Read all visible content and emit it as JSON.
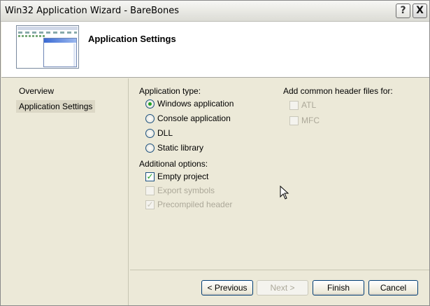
{
  "window": {
    "title": "Win32 Application Wizard - BareBones"
  },
  "titlebar": {
    "help": "?",
    "close": "X"
  },
  "header": {
    "title": "Application Settings",
    "thumbnail_icon": "window-preview-icon"
  },
  "nav": {
    "items": [
      {
        "label": "Overview",
        "selected": false
      },
      {
        "label": "Application Settings",
        "selected": true
      }
    ]
  },
  "app_type": {
    "label": "Application type:",
    "options": [
      {
        "label": "Windows application",
        "checked": true
      },
      {
        "label": "Console application",
        "checked": false
      },
      {
        "label": "DLL",
        "checked": false
      },
      {
        "label": "Static library",
        "checked": false
      }
    ]
  },
  "additional": {
    "label": "Additional options:",
    "options": [
      {
        "label": "Empty project",
        "checked": true,
        "enabled": true
      },
      {
        "label": "Export symbols",
        "checked": false,
        "enabled": false
      },
      {
        "label": "Precompiled header",
        "checked": true,
        "enabled": false
      }
    ]
  },
  "headers": {
    "label": "Add common header files for:",
    "options": [
      {
        "label": "ATL",
        "checked": false,
        "enabled": false
      },
      {
        "label": "MFC",
        "checked": false,
        "enabled": false
      }
    ]
  },
  "buttons": {
    "previous": "< Previous",
    "next": "Next >",
    "finish": "Finish",
    "cancel": "Cancel"
  },
  "colors": {
    "accent_check": "#21a121",
    "disabled_text": "#aca899"
  }
}
